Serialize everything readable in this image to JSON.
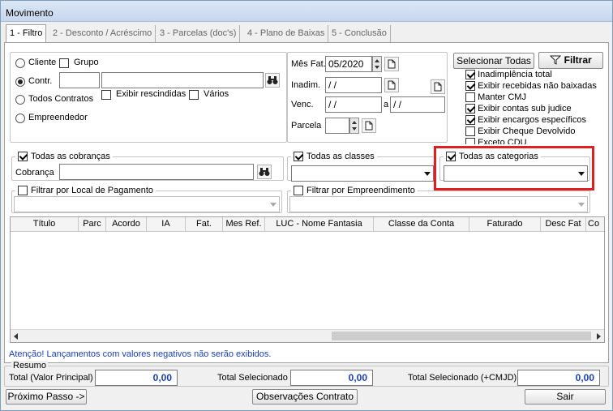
{
  "window": {
    "title": "Movimento"
  },
  "tabs": [
    {
      "label": "1 - Filtro"
    },
    {
      "label": "2 - Desconto / Acréscimo"
    },
    {
      "label": "3 - Parcelas (doc's)"
    },
    {
      "label": "4 - Plano de Baixas"
    },
    {
      "label": "5 - Conclusão"
    }
  ],
  "entity": {
    "radio_cliente": "Cliente",
    "check_grupo": "Grupo",
    "radio_contr": "Contr.",
    "check_rescindidas": "Exibir rescindidas",
    "check_varios": "Vários",
    "radio_todos": "Todos Contratos",
    "radio_empreendedor": "Empreendedor",
    "selected": "Contr."
  },
  "dates": {
    "mes_fat_label": "Mês Fat.",
    "mes_fat_value": "05/2020",
    "inadim_label": "Inadim.",
    "inadim_value": " / /",
    "venc_label": "Venc.",
    "venc_from": " / /",
    "venc_sep": "a",
    "venc_to": " / /",
    "parcela_label": "Parcela",
    "parcela_value": ""
  },
  "filters": {
    "selecionar_todas": "Selecionar Todas",
    "filtrar": "Filtrar",
    "options": [
      {
        "label": "Inadimplência total",
        "checked": true
      },
      {
        "label": "Exibir recebidas não baixadas",
        "checked": true
      },
      {
        "label": "Manter CMJ",
        "checked": false
      },
      {
        "label": "Exibir contas sub judice",
        "checked": true
      },
      {
        "label": "Exibir encargos específicos",
        "checked": true
      },
      {
        "label": "Exibir Cheque Devolvido",
        "checked": false
      },
      {
        "label": "Exceto CDU",
        "checked": false
      }
    ]
  },
  "cobrancas": {
    "legend": "Todas as cobranças",
    "label": "Cobrança",
    "value": ""
  },
  "classes": {
    "legend": "Todas as classes"
  },
  "categorias": {
    "legend": "Todas as categorias"
  },
  "local_pagamento": {
    "legend": "Filtrar por Local de Pagamento"
  },
  "empreendimento": {
    "legend": "Filtrar por Empreendimento"
  },
  "grid": {
    "columns": [
      "Título",
      "Parc",
      "Acordo",
      "IA",
      "Fat.",
      "Mes Ref.",
      "LUC - Nome Fantasia",
      "Classe da Conta",
      "Faturado",
      "Desc Fat",
      "Co"
    ]
  },
  "warning": "Atenção! Lançamentos com valores negativos não serão exibidos.",
  "resumo": {
    "legend": "Resumo",
    "total_principal_label": "Total (Valor Principal)",
    "total_principal": "0,00",
    "total_selecionado_label": "Total Selecionado",
    "total_selecionado": "0,00",
    "total_cmjd_label": "Total Selecionado (+CMJD)",
    "total_cmjd": "0,00"
  },
  "footer": {
    "proximo": "Próximo Passo ->",
    "observacoes": "Observações Contrato",
    "sair": "Sair"
  }
}
